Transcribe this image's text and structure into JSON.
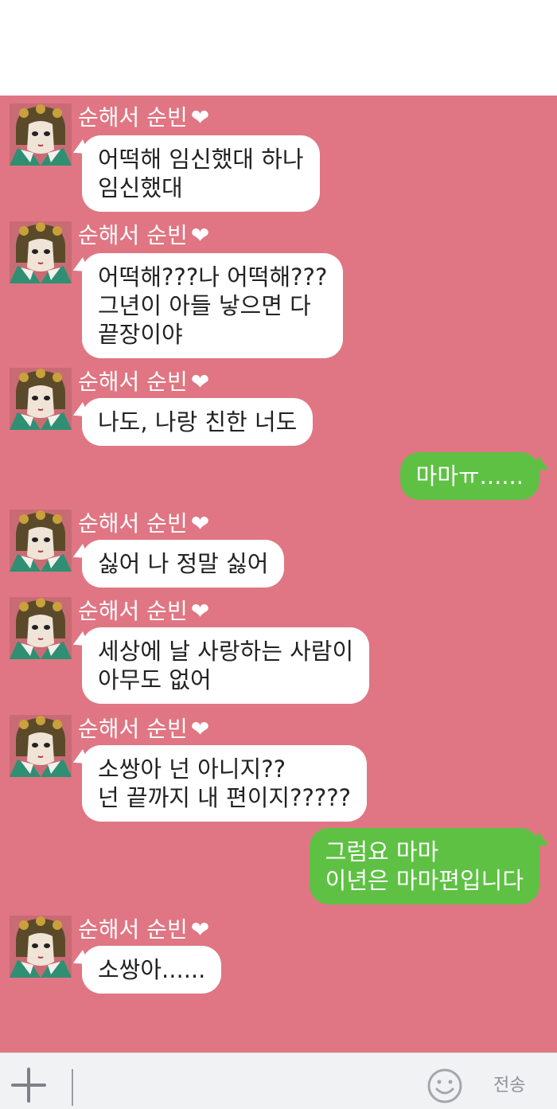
{
  "chat": {
    "messages": [
      {
        "side": "in",
        "sender": "순해서 순빈",
        "heart": "❤",
        "text": "어떡해 임신했대 하나\n임신했대"
      },
      {
        "side": "in",
        "sender": "순해서 순빈",
        "heart": "❤",
        "text": "어떡해???나 어떡해???\n그년이 아들 낳으면 다\n끝장이야"
      },
      {
        "side": "in",
        "sender": "순해서 순빈",
        "heart": "❤",
        "text": "나도, 나랑 친한 너도"
      },
      {
        "side": "out",
        "text": "마마ㅠ......"
      },
      {
        "side": "in",
        "sender": "순해서 순빈",
        "heart": "❤",
        "text": "싫어 나 정말 싫어"
      },
      {
        "side": "in",
        "sender": "순해서 순빈",
        "heart": "❤",
        "text": "세상에 날 사랑하는 사람이\n아무도 없어"
      },
      {
        "side": "in",
        "sender": "순해서 순빈",
        "heart": "❤",
        "text": "소쌍아 넌 아니지??\n넌 끝까지 내 편이지?????"
      },
      {
        "side": "out",
        "text": "그럼요 마마\n이년은 마마편입니다"
      },
      {
        "side": "in",
        "sender": "순해서 순빈",
        "heart": "❤",
        "text": "소쌍아......"
      }
    ]
  },
  "input_bar": {
    "add_icon": "plus-icon",
    "emoji_icon": "smiley-icon",
    "send_label": "전송"
  },
  "colors": {
    "chat_background": "#e07683",
    "incoming_bubble": "#ffffff",
    "outgoing_bubble": "#5ec144",
    "input_bar": "#f1f2f4"
  }
}
